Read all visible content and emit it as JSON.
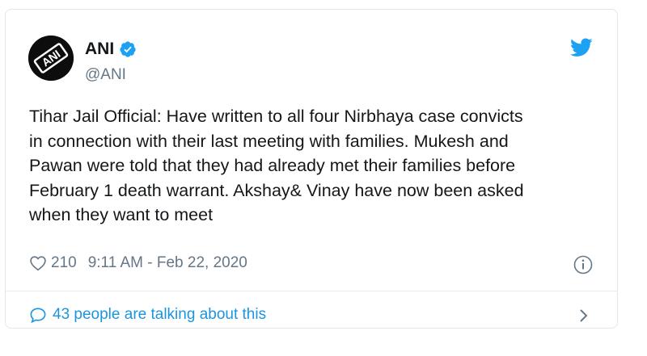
{
  "tweet": {
    "author": {
      "display_name": "ANI",
      "handle": "@ANI",
      "avatar_text": "ANI",
      "avatar_icon": "ani-logo",
      "verified_icon": "verified-badge-icon"
    },
    "platform_icon": "twitter-bird-icon",
    "text": "Tihar Jail Official: Have written to all four Nirbhaya case convicts\nin connection with their last meeting with families. Mukesh and\nPawan were told that they had already met their families before\nFebruary 1 death warrant. Akshay& Vinay have now been asked\nwhen they want to meet",
    "likes": "210",
    "timestamp": "9:11 AM - Feb 22, 2020",
    "talking_text": "43 people are talking about this",
    "colors": {
      "accent": "#1b95e0",
      "secondary_text": "#657786",
      "primary_text": "#14171a",
      "border": "#e1e8ed"
    }
  }
}
